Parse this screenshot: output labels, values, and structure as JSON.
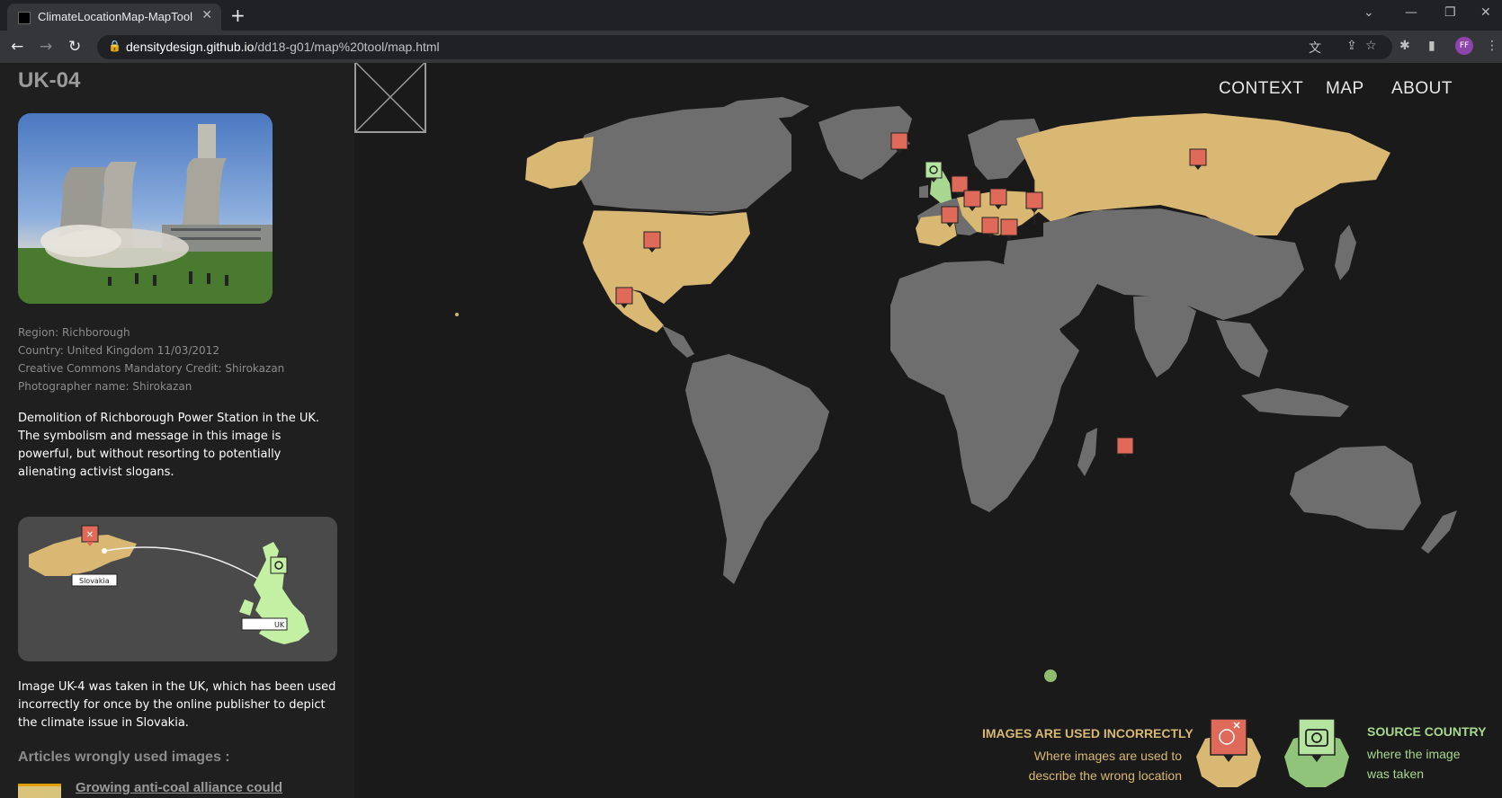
{
  "browser": {
    "tab_title": "ClimateLocationMap-MapTool",
    "url_host": "densitydesign.github.io",
    "url_path": "/dd18-g01/map%20tool/map.html",
    "profile_initials": "FF"
  },
  "sidebar": {
    "image_id": "UK-04",
    "meta": {
      "region": "Region: Richborough",
      "country": "Country: United Kingdom 11/03/2012",
      "credit": "Creative Commons Mandatory Credit: Shirokazan",
      "photographer": "Photographer name: Shirokazan"
    },
    "description": "Demolition of Richborough Power Station in the UK. The symbolism and message in this image is powerful, but without resorting to potentially alienating activist slogans.",
    "mini_map": {
      "label_wrong": "Slovakia",
      "label_source": "UK"
    },
    "description2": "Image UK-4 was taken in the UK, which has been used incorrectly for once by the online publisher to depict the climate issue in Slovakia.",
    "articles_heading": "Articles wrongly used images :",
    "article_link": "Growing anti-coal alliance could"
  },
  "nav": {
    "context": "CONTEXT",
    "map": "MAP",
    "about": "ABOUT"
  },
  "legend": {
    "incorrect_title": "IMAGES ARE USED INCORRECTLY",
    "incorrect_sub1": "Where images are used to",
    "incorrect_sub2": "describe the wrong location",
    "source_title": "SOURCE COUNTRY",
    "source_sub1": "where the image",
    "source_sub2": "was taken"
  },
  "colors": {
    "highlight_country": "#d8b873",
    "source_country": "#a8d890",
    "other_country": "#6e6e6e",
    "marker_incorrect": "#e06a5a",
    "marker_source": "#b5e3a0",
    "legend_incorrect_text": "#d8b873",
    "legend_source_text": "#a8d890"
  },
  "icons": {
    "incorrect_marker": "location-cross-icon",
    "source_marker": "camera-icon"
  }
}
